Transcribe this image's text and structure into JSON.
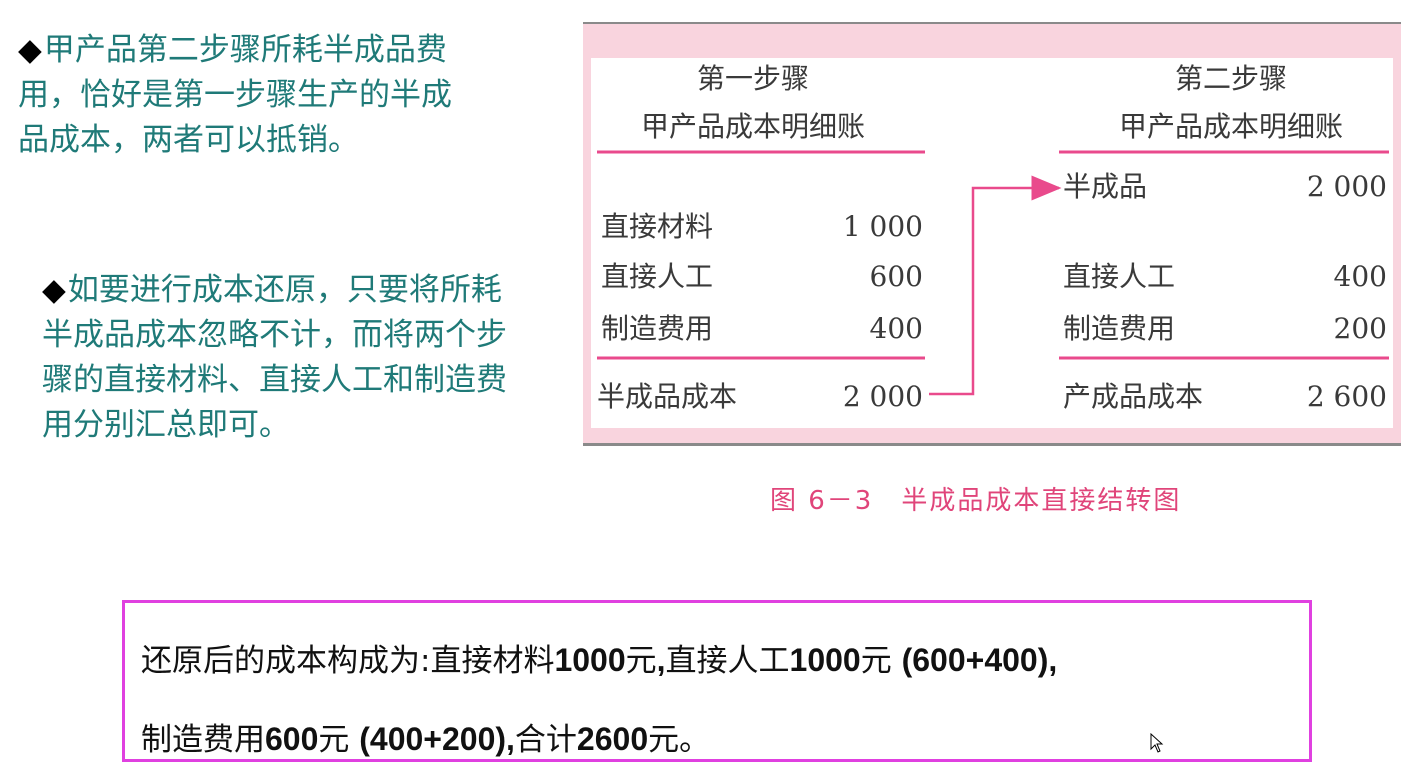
{
  "left_notes": {
    "note1": {
      "bullet": "◆",
      "text": "甲产品第二步骤所耗半成品费用，恰好是第一步骤生产的半成品成本，两者可以抵销。"
    },
    "note2": {
      "bullet": "◆",
      "text": "如要进行成本还原，只要将所耗半成品成本忽略不计，而将两个步骤的直接材料、直接人工和制造费用分别汇总即可。"
    }
  },
  "figure": {
    "step1": {
      "title": "第一步骤",
      "subtitle": "甲产品成本明细账",
      "rows": [
        {
          "label": "直接材料",
          "value": "1 000"
        },
        {
          "label": "直接人工",
          "value": "600"
        },
        {
          "label": "制造费用",
          "value": "400"
        }
      ],
      "total_label": "半成品成本",
      "total_value": "2 000"
    },
    "step2": {
      "title": "第二步骤",
      "subtitle": "甲产品成本明细账",
      "transfer_label": "半成品",
      "transfer_value": "2 000",
      "rows": [
        {
          "label": "直接人工",
          "value": "400"
        },
        {
          "label": "制造费用",
          "value": "200"
        }
      ],
      "total_label": "产成品成本",
      "total_value": "2 600"
    },
    "colors": {
      "background": "#f9d4de",
      "rule": "#e94a8c",
      "arrow": "#e94a8c"
    }
  },
  "caption": "图 6－3　半成品成本直接结转图",
  "summary": {
    "line1": [
      {
        "t": "还原后的成本构成为:",
        "b": false
      },
      {
        "t": "直接材料",
        "b": false
      },
      {
        "t": "1000",
        "b": true
      },
      {
        "t": "元",
        "b": false
      },
      {
        "t": ",",
        "b": true
      },
      {
        "t": "直接人工",
        "b": false
      },
      {
        "t": "1000",
        "b": true
      },
      {
        "t": "元 ",
        "b": false
      },
      {
        "t": "(600+400),",
        "b": true
      }
    ],
    "line2": [
      {
        "t": "制造费用",
        "b": false
      },
      {
        "t": "600",
        "b": true
      },
      {
        "t": "元 ",
        "b": false
      },
      {
        "t": "(400+200),",
        "b": true
      },
      {
        "t": "合计",
        "b": false
      },
      {
        "t": "2600",
        "b": true
      },
      {
        "t": "元。",
        "b": false
      }
    ]
  }
}
